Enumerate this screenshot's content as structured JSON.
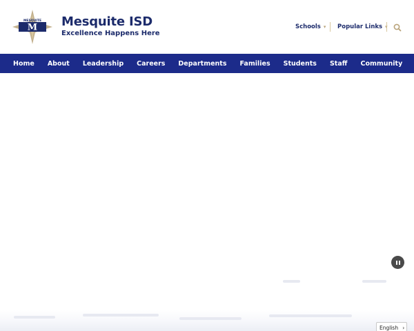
{
  "brand": {
    "name": "Mesquite ISD",
    "tagline": "Excellence Happens Here",
    "logo_letters": "M",
    "logo_text": "MESQUITE",
    "colors": {
      "navy": "#1c2b6b",
      "nav_bg": "#1c2b8a",
      "gold": "#b9a37a"
    }
  },
  "utility": {
    "schools_label": "Schools",
    "popular_links_label": "Popular Links",
    "dropdown_icon": "chevron-down-icon",
    "search_icon": "search-icon"
  },
  "nav": {
    "items": [
      {
        "label": "Home"
      },
      {
        "label": "About"
      },
      {
        "label": "Leadership"
      },
      {
        "label": "Careers"
      },
      {
        "label": "Departments"
      },
      {
        "label": "Families"
      },
      {
        "label": "Students"
      },
      {
        "label": "Staff"
      },
      {
        "label": "Community"
      }
    ]
  },
  "hero": {
    "pause_icon": "pause-icon"
  },
  "language": {
    "selected": "English",
    "chevron": "›"
  }
}
